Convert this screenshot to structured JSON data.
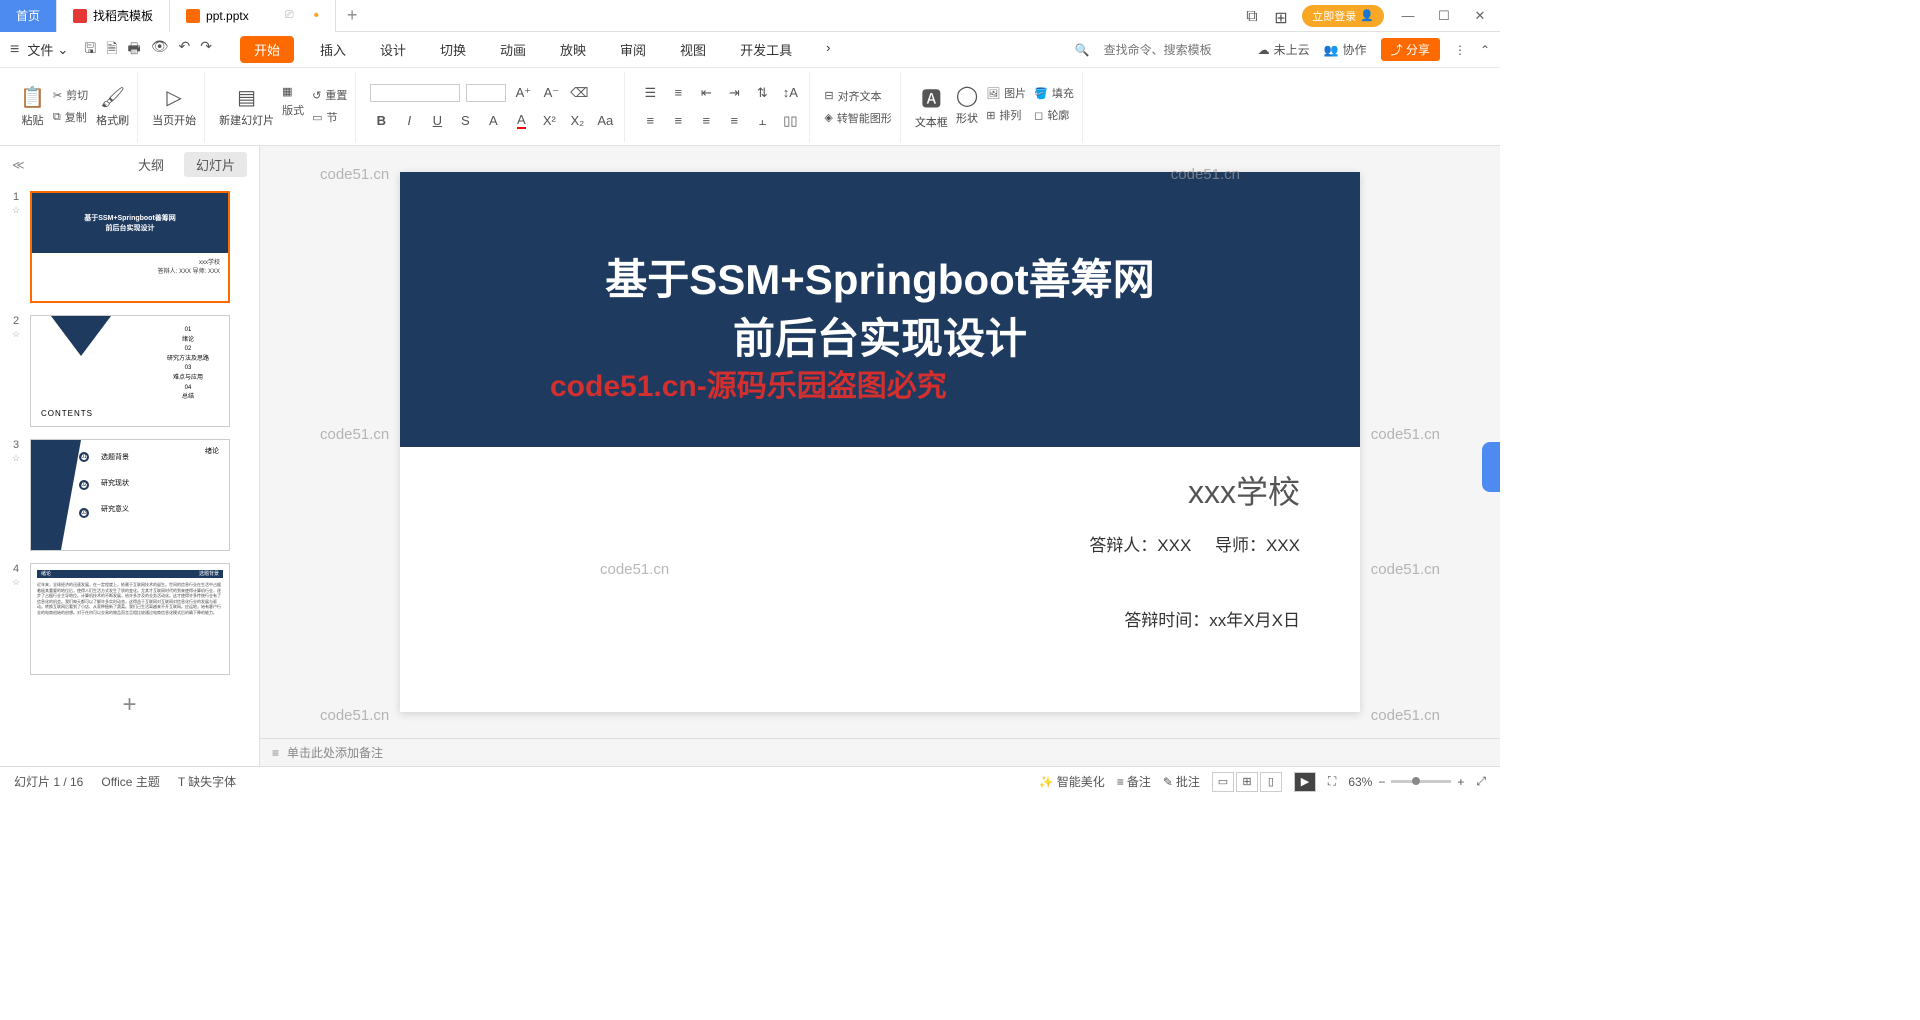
{
  "tabs": {
    "home": "首页",
    "template": "找稻壳模板",
    "file": "ppt.pptx"
  },
  "titlebar": {
    "login": "立即登录"
  },
  "menu": {
    "file": "文件",
    "start": "开始",
    "insert": "插入",
    "design": "设计",
    "switch": "切换",
    "anim": "动画",
    "show": "放映",
    "review": "审阅",
    "view": "视图",
    "dev": "开发工具",
    "search_ph": "查找命令、搜索模板",
    "cloud": "未上云",
    "collab": "协作",
    "share": "分享"
  },
  "ribbon": {
    "paste": "粘贴",
    "cut": "剪切",
    "copy": "复制",
    "format_painter": "格式刷",
    "from_current": "当页开始",
    "new_slide": "新建幻灯片",
    "layout": "版式",
    "section": "节",
    "reset": "重置",
    "align_text": "对齐文本",
    "smart_art": "转智能图形",
    "textbox": "文本框",
    "shape": "形状",
    "picture": "图片",
    "arrange": "排列",
    "fill": "填充",
    "outline": "轮廓"
  },
  "side": {
    "outline": "大纲",
    "slides": "幻灯片"
  },
  "thumbs": {
    "t1": {
      "l1": "基于SSM+Springboot善筹网",
      "l2": "前后台实现设计",
      "school": "xxx学校",
      "meta": "答辩人: XXX    导师: XXX"
    },
    "t2": {
      "n1": "01",
      "i1": "绪论",
      "n2": "02",
      "i2": "研究方法及思路",
      "n3": "03",
      "i3": "难点与应用",
      "n4": "04",
      "i4": "总结",
      "contents": "CONTENTS"
    },
    "t3": {
      "title": "绪论",
      "d1": "01",
      "d2": "02",
      "d3": "03",
      "i1": "选题背景",
      "i2": "研究现状",
      "i3": "研究意义"
    },
    "t4": {
      "bar_l": "绪论",
      "bar_r": "选题背景",
      "body": "近年来，全球经济的迅速发展，在一定程度上，依赖于互联网技术的诞生。世间的信息行业在生活中占据着极其重要的地位后，使得人们生活方式发生了质的变化。尤其才互联网时代的到来使得计算机行业，逐步了占据行业主导地位。计算机技术的不断发展，给许多涉及的业务活动化。这才使得许多传统行业有了信息化的机会。我们每天都可以了解许多实时动态，这得益于互联网对互联网对信息化行业的发展与驱动。转换互联网后看到了小店、从家种植新了蔬菜。我们已生活离越来不开互联网。应运地，始有客户行业的电商创始的创想。对于任何可以交易的物品而言且相比较通过电商信息化模式后的确下降的能力。"
    }
  },
  "slide": {
    "title_l1": "基于SSM+Springboot善筹网",
    "title_l2": "前后台实现设计",
    "school": "xxx学校",
    "presenter": "答辩人：XXX",
    "tutor": "导师：XXX",
    "date": "答辩时间：xx年X月X日"
  },
  "watermarks": {
    "wm": "code51.cn",
    "red": "code51.cn-源码乐园盗图必究"
  },
  "notes": {
    "placeholder": "单击此处添加备注"
  },
  "status": {
    "slide_count": "幻灯片 1 / 16",
    "theme": "Office 主题",
    "missing_font": "缺失字体",
    "beautify": "智能美化",
    "notes": "备注",
    "comments": "批注",
    "zoom": "63%"
  }
}
